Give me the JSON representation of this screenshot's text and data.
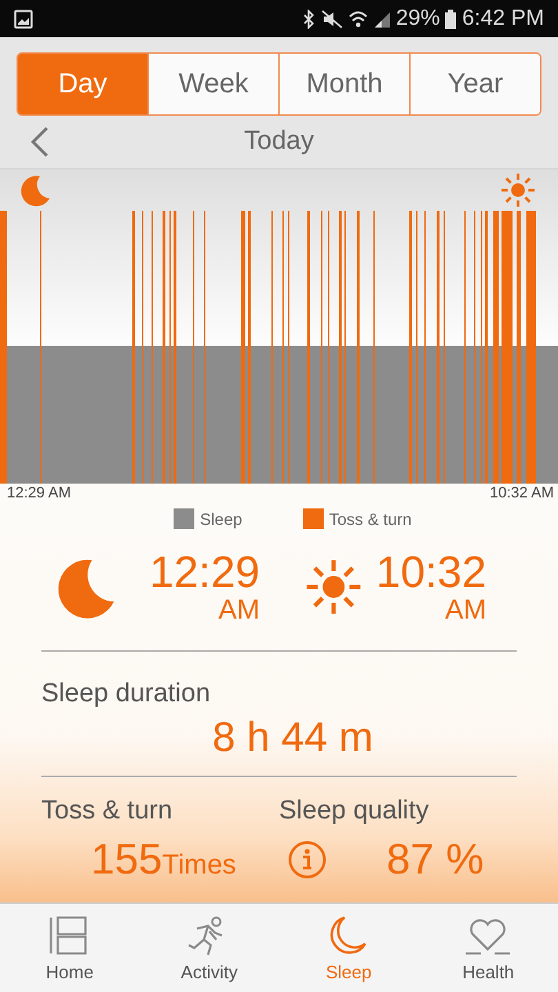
{
  "status_bar": {
    "battery": "29%",
    "time": "6:42 PM"
  },
  "tabs": [
    {
      "label": "Day",
      "selected": true
    },
    {
      "label": "Week",
      "selected": false
    },
    {
      "label": "Month",
      "selected": false
    },
    {
      "label": "Year",
      "selected": false
    }
  ],
  "date_nav": {
    "title": "Today"
  },
  "chart": {
    "start_label": "12:29 AM",
    "end_label": "10:32 AM"
  },
  "legend": [
    {
      "label": "Sleep",
      "color": "#8c8c8c"
    },
    {
      "label": "Toss & turn",
      "color": "#f06a0f"
    }
  ],
  "sleep_times": {
    "bedtime": "12:29",
    "bedtime_period": "AM",
    "wake": "10:32",
    "wake_period": "AM"
  },
  "duration": {
    "label": "Sleep duration",
    "value": "8 h 44 m"
  },
  "toss_turn": {
    "label": "Toss & turn",
    "count": "155",
    "unit": "Times"
  },
  "quality": {
    "label": "Sleep quality",
    "value": "87 %"
  },
  "nav": [
    {
      "label": "Home",
      "selected": false
    },
    {
      "label": "Activity",
      "selected": false
    },
    {
      "label": "Sleep",
      "selected": true
    },
    {
      "label": "Health",
      "selected": false
    }
  ]
}
